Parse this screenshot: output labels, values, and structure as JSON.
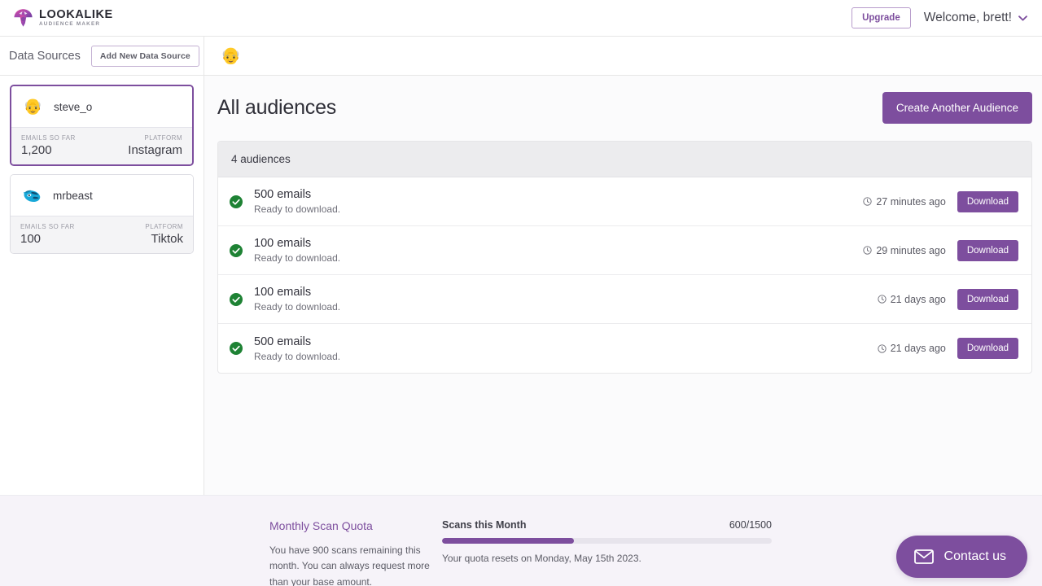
{
  "brand": {
    "name": "LOOKALIKE",
    "tagline": "AUDIENCE MAKER",
    "accent": "#7d4e9e",
    "logo_icon": "lookalike-logo-icon"
  },
  "topbar": {
    "upgrade_label": "Upgrade",
    "welcome_label": "Welcome, brett!",
    "chevron_icon": "chevron-down-icon"
  },
  "subbar": {
    "data_sources_label": "Data Sources",
    "add_data_source_label": "Add New Data Source",
    "active_avatar_icon": "older-person-avatar-icon"
  },
  "sidebar": {
    "cards": [
      {
        "name": "steve_o",
        "avatar_icon": "older-person-avatar-icon",
        "selected": true,
        "emails_label": "EMAILS SO FAR",
        "emails_value": "1,200",
        "platform_label": "PLATFORM",
        "platform_value": "Instagram"
      },
      {
        "name": "mrbeast",
        "avatar_icon": "beast-mascot-avatar-icon",
        "selected": false,
        "emails_label": "EMAILS SO FAR",
        "emails_value": "100",
        "platform_label": "PLATFORM",
        "platform_value": "Tiktok"
      }
    ]
  },
  "main": {
    "page_title": "All audiences",
    "create_button_label": "Create Another Audience",
    "panel_header": "4 audiences",
    "audiences": [
      {
        "status_icon": "check-circle-icon",
        "title": "500 emails",
        "subtitle": "Ready to download.",
        "time_icon": "clock-icon",
        "time": "27 minutes ago",
        "download_label": "Download"
      },
      {
        "status_icon": "check-circle-icon",
        "title": "100 emails",
        "subtitle": "Ready to download.",
        "time_icon": "clock-icon",
        "time": "29 minutes ago",
        "download_label": "Download"
      },
      {
        "status_icon": "check-circle-icon",
        "title": "100 emails",
        "subtitle": "Ready to download.",
        "time_icon": "clock-icon",
        "time": "21 days ago",
        "download_label": "Download"
      },
      {
        "status_icon": "check-circle-icon",
        "title": "500 emails",
        "subtitle": "Ready to download.",
        "time_icon": "clock-icon",
        "time": "21 days ago",
        "download_label": "Download"
      }
    ]
  },
  "footer": {
    "quota_title": "Monthly Scan Quota",
    "quota_description": "You have 900 scans remaining this month. You can always request more than your base amount.",
    "scans_label": "Scans this Month",
    "scans_count": "600/1500",
    "progress_percent": 40,
    "reset_text": "Your quota resets on Monday, May 15th 2023.",
    "contact_label": "Contact us",
    "contact_icon": "envelope-icon"
  }
}
